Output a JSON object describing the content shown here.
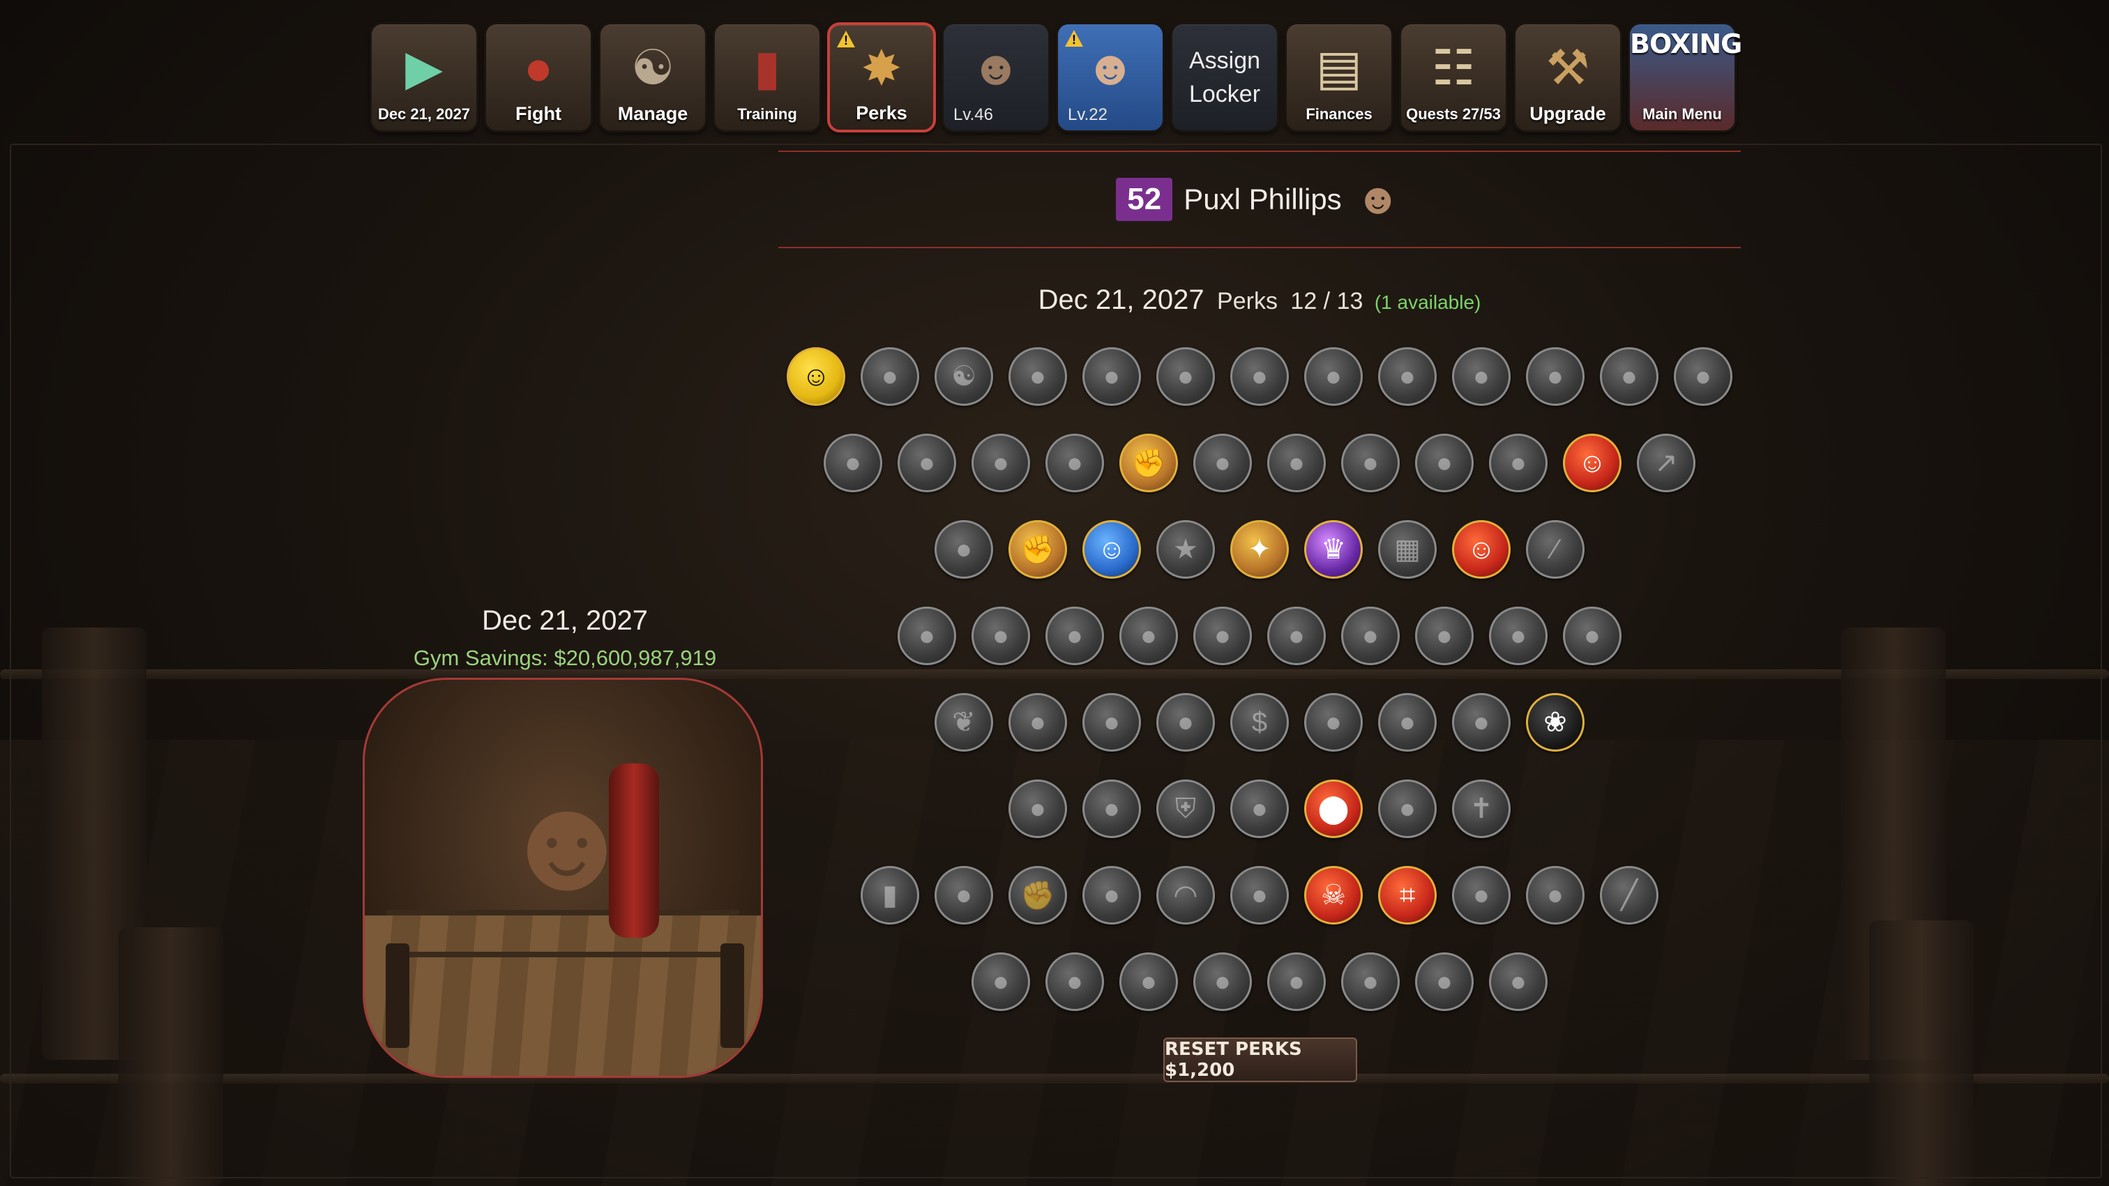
{
  "nav": {
    "continue": {
      "label": "Dec 21, 2027",
      "icon": "play-icon"
    },
    "fight": {
      "label": "Fight",
      "icon": "boxing-gloves-icon"
    },
    "manage": {
      "label": "Manage",
      "icon": "handshake-icon"
    },
    "training": {
      "label": "Training",
      "icon": "punching-bag-icon"
    },
    "perks": {
      "label": "Perks",
      "icon": "compass-icon",
      "warning": true
    },
    "boxer1": {
      "level": "Lv.46",
      "icon": "boxer-portrait-icon"
    },
    "boxer2": {
      "level": "Lv.22",
      "icon": "boxer-portrait-icon",
      "warning": true
    },
    "assign_locker": {
      "line1": "Assign",
      "line2": "Locker"
    },
    "finances": {
      "label": "Finances",
      "icon": "ledger-book-icon"
    },
    "quests": {
      "label": "Quests 27/53",
      "icon": "scroll-icon"
    },
    "upgrade": {
      "label": "Upgrade",
      "icon": "hammer-icon"
    },
    "main_menu": {
      "label": "Main Menu",
      "logo": "BOXING"
    }
  },
  "fighter": {
    "level": "52",
    "name": "Puxl Phillips",
    "avatar_icon": "boxer-avatar-icon"
  },
  "perks_header": {
    "date": "Dec 21, 2027",
    "word": "Perks",
    "count": "12  /  13",
    "available": "(1 available)"
  },
  "perk_rows": [
    [
      {
        "icon": "silhouette-icon",
        "active": true,
        "tint": "gold"
      },
      {
        "icon": "perk-icon"
      },
      {
        "icon": "handshake-icon"
      },
      {
        "icon": "perk-icon"
      },
      {
        "icon": "perk-icon"
      },
      {
        "icon": "perk-icon"
      },
      {
        "icon": "perk-icon"
      },
      {
        "icon": "perk-icon"
      },
      {
        "icon": "perk-icon"
      },
      {
        "icon": "perk-icon"
      },
      {
        "icon": "perk-icon"
      },
      {
        "icon": "perk-icon"
      },
      {
        "icon": "perk-icon"
      }
    ],
    [
      {
        "icon": "perk-icon"
      },
      {
        "icon": "perk-icon"
      },
      {
        "icon": "perk-icon"
      },
      {
        "icon": "perk-icon"
      },
      {
        "icon": "flex-arm-icon",
        "active": true
      },
      {
        "icon": "perk-icon"
      },
      {
        "icon": "perk-icon"
      },
      {
        "icon": "perk-icon"
      },
      {
        "icon": "perk-icon"
      },
      {
        "icon": "perk-icon"
      },
      {
        "icon": "muscle-man-icon",
        "active": true,
        "tint": "red"
      },
      {
        "icon": "chart-icon"
      }
    ],
    [
      {
        "icon": "perk-icon"
      },
      {
        "icon": "fist-icon",
        "active": true
      },
      {
        "icon": "fighter-icon",
        "active": true,
        "tint": "blue"
      },
      {
        "icon": "medal-icon"
      },
      {
        "icon": "glow-fighter-icon",
        "active": true
      },
      {
        "icon": "champion-icon",
        "active": true,
        "tint": "purple"
      },
      {
        "icon": "cage-icon"
      },
      {
        "icon": "red-fighter-icon",
        "active": true,
        "tint": "red"
      },
      {
        "icon": "blade-icon"
      }
    ],
    [
      {
        "icon": "perk-icon"
      },
      {
        "icon": "perk-icon"
      },
      {
        "icon": "perk-icon"
      },
      {
        "icon": "perk-icon"
      },
      {
        "icon": "perk-icon"
      },
      {
        "icon": "perk-icon"
      },
      {
        "icon": "perk-icon"
      },
      {
        "icon": "perk-icon"
      },
      {
        "icon": "perk-icon"
      },
      {
        "icon": "perk-icon"
      }
    ],
    [
      {
        "icon": "feather-icon"
      },
      {
        "icon": "perk-icon"
      },
      {
        "icon": "perk-icon"
      },
      {
        "icon": "perk-icon"
      },
      {
        "icon": "dollar-icon"
      },
      {
        "icon": "perk-icon"
      },
      {
        "icon": "perk-icon"
      },
      {
        "icon": "perk-icon"
      },
      {
        "icon": "rose-icon",
        "active": true,
        "tint": "dark"
      }
    ],
    [
      {
        "icon": "perk-icon"
      },
      {
        "icon": "perk-icon"
      },
      {
        "icon": "shield-icon"
      },
      {
        "icon": "perk-icon"
      },
      {
        "icon": "helmet-icon",
        "active": true,
        "tint": "red"
      },
      {
        "icon": "perk-icon"
      },
      {
        "icon": "cross-icon"
      }
    ],
    [
      {
        "icon": "bottle-icon"
      },
      {
        "icon": "perk-icon"
      },
      {
        "icon": "fist-icon"
      },
      {
        "icon": "perk-icon"
      },
      {
        "icon": "dome-icon"
      },
      {
        "icon": "perk-icon"
      },
      {
        "icon": "skull-icon",
        "active": true,
        "tint": "red"
      },
      {
        "icon": "revolver-icon",
        "active": true,
        "tint": "red"
      },
      {
        "icon": "perk-icon"
      },
      {
        "icon": "perk-icon"
      },
      {
        "icon": "syringe-icon"
      }
    ],
    [
      {
        "icon": "perk-icon"
      },
      {
        "icon": "perk-icon"
      },
      {
        "icon": "perk-icon"
      },
      {
        "icon": "perk-icon"
      },
      {
        "icon": "perk-icon"
      },
      {
        "icon": "perk-icon"
      },
      {
        "icon": "perk-icon"
      },
      {
        "icon": "perk-icon"
      }
    ]
  ],
  "left_panel": {
    "date": "Dec 21, 2027",
    "gym_savings": "Gym Savings: $20,600,987,919"
  },
  "reset_button": {
    "label": "RESET PERKS $1,200"
  },
  "colors": {
    "accent": "#c94039",
    "level_badge": "#7a2f8f",
    "savings": "#9bd37e",
    "available": "#7bd46a"
  }
}
